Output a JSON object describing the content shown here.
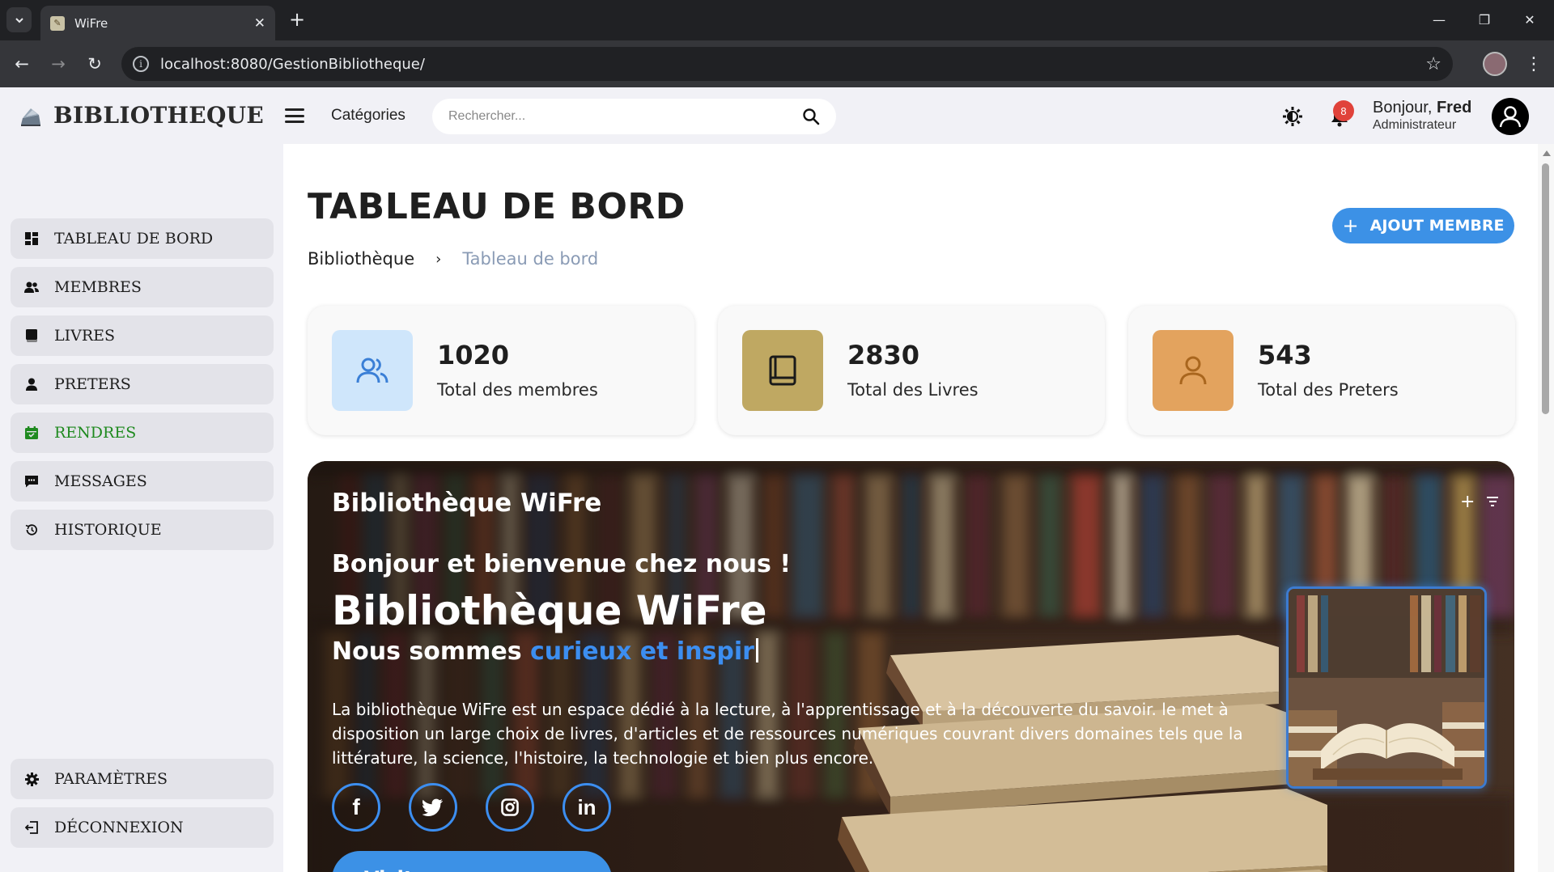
{
  "browser": {
    "tab_title": "WiFre",
    "url": "localhost:8080/GestionBibliotheque/"
  },
  "header": {
    "brand": "BIBLIOTHEQUE",
    "categories": "Catégories",
    "search_placeholder": "Rechercher...",
    "notification_count": "8",
    "greeting": "Bonjour,",
    "user_name": "Fred",
    "user_role": "Administrateur"
  },
  "sidebar": {
    "items": [
      {
        "label": "TABLEAU DE BORD",
        "icon": "dashboard-icon"
      },
      {
        "label": "MEMBRES",
        "icon": "members-icon"
      },
      {
        "label": "LIVRES",
        "icon": "book-icon"
      },
      {
        "label": "PRETERS",
        "icon": "user-icon"
      },
      {
        "label": "RENDRES",
        "icon": "calendar-icon",
        "active": true
      },
      {
        "label": "MESSAGES",
        "icon": "message-icon"
      },
      {
        "label": "HISTORIQUE",
        "icon": "history-icon"
      }
    ],
    "bottom": [
      {
        "label": "PARAMÈTRES",
        "icon": "gear-icon"
      },
      {
        "label": "DÉCONNEXION",
        "icon": "logout-icon"
      }
    ],
    "active_color": "#1f8a1f"
  },
  "main": {
    "title": "TABLEAU DE BORD",
    "breadcrumb": [
      "Bibliothèque",
      "Tableau de bord"
    ],
    "add_button": "AJOUT MEMBRE",
    "stats": [
      {
        "value": "1020",
        "label": "Total des membres",
        "icon": "members-icon",
        "color": "#cfe6fb"
      },
      {
        "value": "2830",
        "label": "Total des Livres",
        "icon": "book-icon",
        "color": "#bfa862"
      },
      {
        "value": "543",
        "label": "Total des Preters",
        "icon": "user-icon",
        "color": "#e3a35e"
      }
    ],
    "hero": {
      "title": "Bibliothèque WiFre",
      "welcome": "Bonjour et bienvenue chez nous !",
      "big_title": "Bibliothèque WiFre",
      "tagline_start": "Nous sommes ",
      "tagline_highlight": "curieux et inspir",
      "description": "La bibliothèque WiFre est un espace dédié à la lecture, à l'apprentissage et à la découverte du savoir. le met à disposition un large choix de livres, d'articles et de ressources numériques couvrant divers domaines tels que la littérature, la science, l'histoire, la technologie et bien plus encore.",
      "socials": [
        "facebook-icon",
        "twitter-icon",
        "instagram-icon",
        "linkedin-icon"
      ],
      "visit_button": "Visitez nous maintenant"
    },
    "accent": "#3c91e6"
  }
}
